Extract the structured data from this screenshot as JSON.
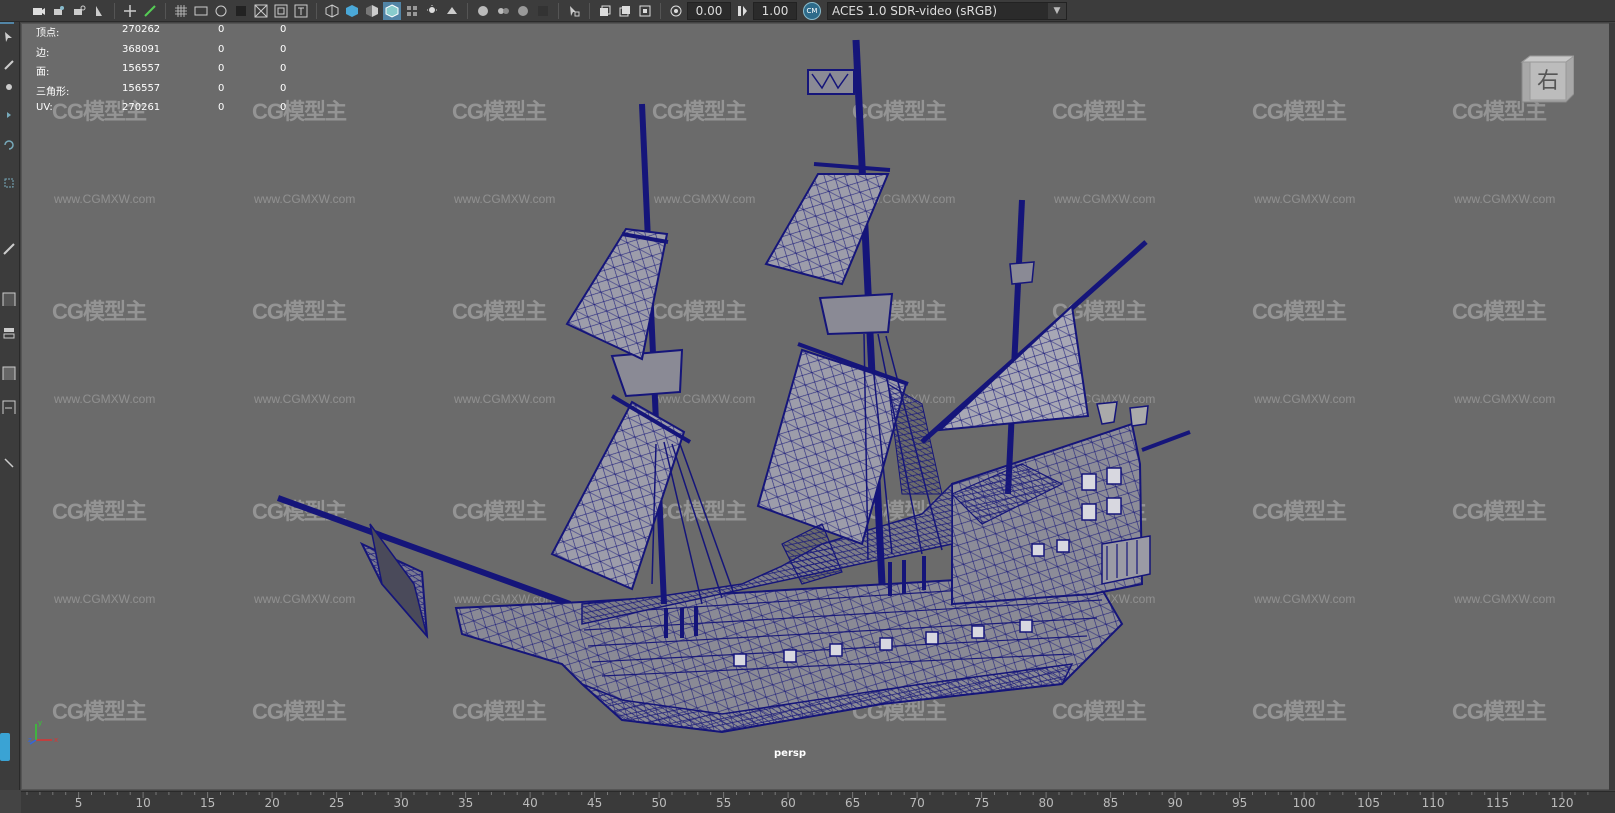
{
  "toolbar": {
    "exposure": "0.00",
    "gamma": "1.00",
    "color_space": "ACES 1.0 SDR-video (sRGB)",
    "icons": [
      "camera-icon",
      "camera-attr-icon",
      "bookmark-icon",
      "image-plane-icon",
      "2d-pan-icon",
      "grease-pencil-icon",
      "grid-icon",
      "film-gate-icon",
      "resolution-gate-icon",
      "gate-mask-icon",
      "field-chart-icon",
      "safe-action-icon",
      "safe-title-icon",
      "wireframe-icon",
      "smooth-shade-icon",
      "flat-shade-icon",
      "wireframe-on-shaded-icon",
      "xray-icon",
      "use-lights-icon",
      "shadows-icon",
      "screen-ao-icon",
      "motion-blur-icon",
      "aa-icon",
      "depth-of-field-icon",
      "isolate-select-icon",
      "xray-joints-icon",
      "xray-active-icon",
      "exposure-icon",
      "gamma-icon",
      "color-management-icon"
    ]
  },
  "hud": {
    "rows": [
      {
        "label": "顶点:",
        "total": "270262",
        "selected": "0",
        "component": "0"
      },
      {
        "label": "边:",
        "total": "368091",
        "selected": "0",
        "component": "0"
      },
      {
        "label": "面:",
        "total": "156557",
        "selected": "0",
        "component": "0"
      },
      {
        "label": "三角形:",
        "total": "156557",
        "selected": "0",
        "component": "0"
      },
      {
        "label": "UV:",
        "total": "270261",
        "selected": "0",
        "component": "0"
      }
    ]
  },
  "viewcube": {
    "face_label": "右"
  },
  "viewport": {
    "camera": "persp"
  },
  "watermark": {
    "logo": "CG模型主",
    "url": "www.CGMXW.com"
  },
  "axis": {
    "x": "x",
    "y": "y",
    "z": "z"
  },
  "timeline": {
    "ticks": [
      "5",
      "10",
      "15",
      "20",
      "25",
      "30",
      "35",
      "40",
      "45",
      "50",
      "55",
      "60",
      "65",
      "70",
      "75",
      "80",
      "85",
      "90",
      "95",
      "100",
      "105",
      "110",
      "115",
      "120"
    ]
  }
}
